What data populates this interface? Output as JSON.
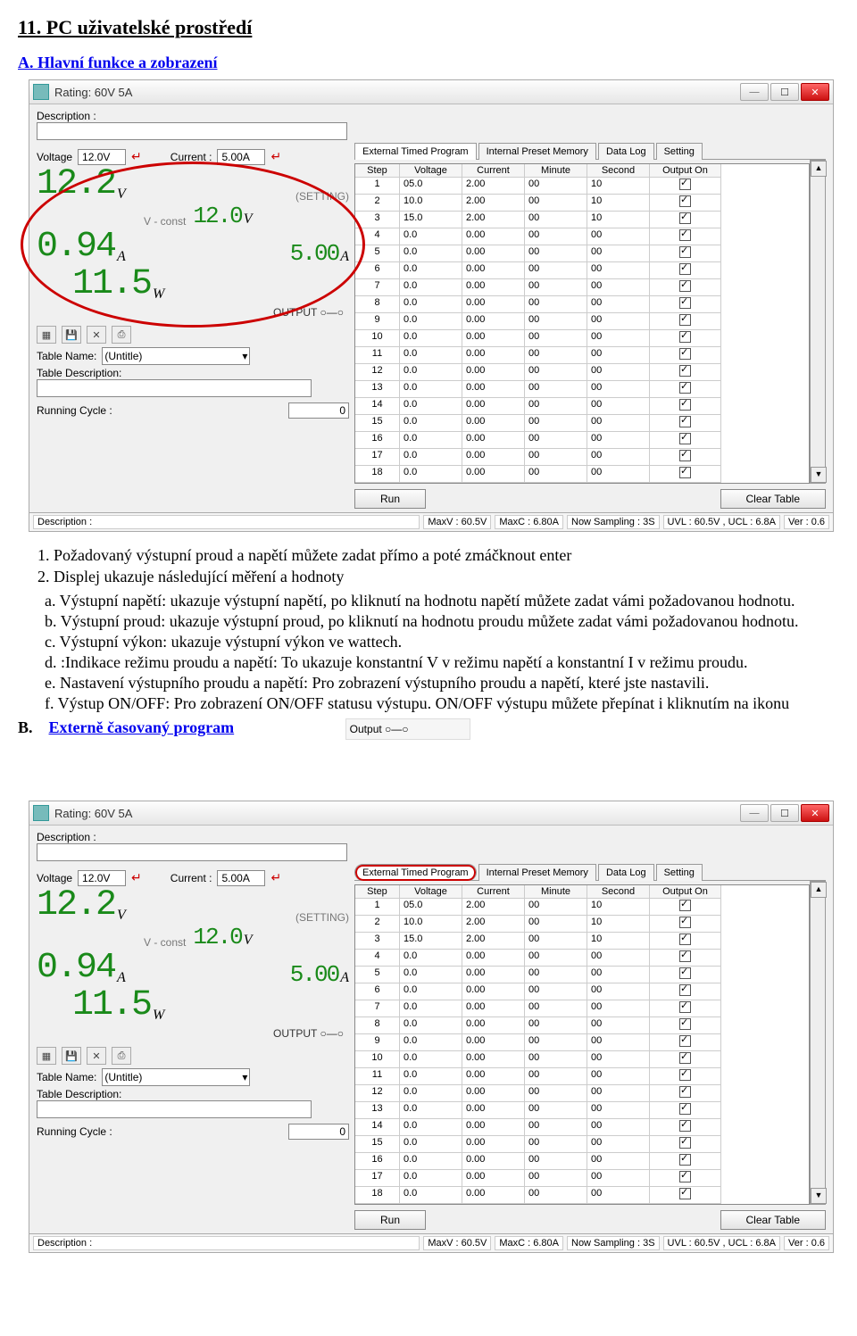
{
  "doc": {
    "title": "11. PC uživatelské prostředí",
    "sectA": "A.     Hlavní funkce a zobrazení",
    "sectB_prefix": "B.",
    "sectB": "Externě časovaný program",
    "output_fig": "Output ○—○"
  },
  "notes": {
    "n1": "Požadovaný výstupní proud a napětí můžete zadat přímo a poté zmáčknout enter",
    "n2": "Displej ukazuje následující měření a hodnoty",
    "a": "Výstupní napětí: ukazuje výstupní napětí, po kliknutí na hodnotu napětí můžete zadat vámi požadovanou hodnotu.",
    "b": "Výstupní proud: ukazuje výstupní proud, po kliknutí na hodnotu proudu můžete zadat vámi požadovanou hodnotu.",
    "c": "Výstupní výkon: ukazuje výstupní výkon ve wattech.",
    "d": ":Indikace režimu proudu a napětí: To ukazuje konstantní V v režimu napětí a konstantní I v režimu proudu.",
    "e": "Nastavení výstupního proudu a napětí: Pro zobrazení výstupního proudu a napětí, které jste nastavili.",
    "f": "Výstup ON/OFF: Pro zobrazení ON/OFF statusu výstupu. ON/OFF výstupu můžete přepínat i kliknutím na ikonu"
  },
  "app": {
    "title": "Rating: 60V 5A",
    "descLabel": "Description :",
    "descValue": "",
    "voltageLabel": "Voltage",
    "voltageValue": "12.0V",
    "currentLabel": "Current :",
    "currentValue": "5.00A",
    "settingText": "(SETTING)",
    "vconst": "V - const",
    "readV": "12.2",
    "readA": "0.94",
    "readW": "11.5",
    "setV": "12.0",
    "setA": "5.00",
    "unitV": "V",
    "unitA": "A",
    "unitW": "W",
    "outputInd": "OUTPUT ○—○",
    "tableNameLabel": "Table Name:",
    "tableNameValue": "(Untitle)",
    "tableDescLabel": "Table Description:",
    "tableDescValue": "",
    "runCycleLabel": "Running Cycle :",
    "runCycleValue": "0",
    "runBtn": "Run",
    "clearBtn": "Clear Table",
    "tabs": [
      "External Timed Program",
      "Internal Preset Memory",
      "Data Log",
      "Setting"
    ],
    "headers": [
      "Step",
      "Voltage",
      "Current",
      "Minute",
      "Second",
      "Output On"
    ],
    "rows": [
      {
        "step": "1",
        "v": "05.0",
        "c": "2.00",
        "m": "00",
        "s": "10"
      },
      {
        "step": "2",
        "v": "10.0",
        "c": "2.00",
        "m": "00",
        "s": "10"
      },
      {
        "step": "3",
        "v": "15.0",
        "c": "2.00",
        "m": "00",
        "s": "10"
      },
      {
        "step": "4",
        "v": "0.0",
        "c": "0.00",
        "m": "00",
        "s": "00"
      },
      {
        "step": "5",
        "v": "0.0",
        "c": "0.00",
        "m": "00",
        "s": "00"
      },
      {
        "step": "6",
        "v": "0.0",
        "c": "0.00",
        "m": "00",
        "s": "00"
      },
      {
        "step": "7",
        "v": "0.0",
        "c": "0.00",
        "m": "00",
        "s": "00"
      },
      {
        "step": "8",
        "v": "0.0",
        "c": "0.00",
        "m": "00",
        "s": "00"
      },
      {
        "step": "9",
        "v": "0.0",
        "c": "0.00",
        "m": "00",
        "s": "00"
      },
      {
        "step": "10",
        "v": "0.0",
        "c": "0.00",
        "m": "00",
        "s": "00"
      },
      {
        "step": "11",
        "v": "0.0",
        "c": "0.00",
        "m": "00",
        "s": "00"
      },
      {
        "step": "12",
        "v": "0.0",
        "c": "0.00",
        "m": "00",
        "s": "00"
      },
      {
        "step": "13",
        "v": "0.0",
        "c": "0.00",
        "m": "00",
        "s": "00"
      },
      {
        "step": "14",
        "v": "0.0",
        "c": "0.00",
        "m": "00",
        "s": "00"
      },
      {
        "step": "15",
        "v": "0.0",
        "c": "0.00",
        "m": "00",
        "s": "00"
      },
      {
        "step": "16",
        "v": "0.0",
        "c": "0.00",
        "m": "00",
        "s": "00"
      },
      {
        "step": "17",
        "v": "0.0",
        "c": "0.00",
        "m": "00",
        "s": "00"
      },
      {
        "step": "18",
        "v": "0.0",
        "c": "0.00",
        "m": "00",
        "s": "00"
      }
    ],
    "status": {
      "desc": "Description :",
      "maxv": "MaxV : 60.5V",
      "maxc": "MaxC : 6.80A",
      "samp": "Now Sampling : 3S",
      "uvl": "UVL : 60.5V , UCL : 6.8A",
      "ver": "Ver : 0.6"
    }
  }
}
